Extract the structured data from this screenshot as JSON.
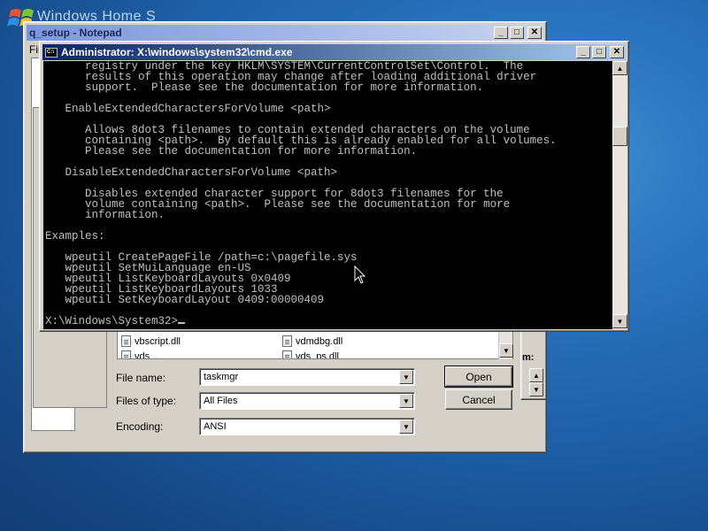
{
  "desktop": {
    "background_text": "Windows Home S"
  },
  "notepad": {
    "title": "q_setup - Notepad",
    "menu_first": "Fil"
  },
  "open_dialog": {
    "files": [
      {
        "name": "vbscript.dll"
      },
      {
        "name": "vdmdbg.dll"
      },
      {
        "name": "vds..."
      },
      {
        "name": "vds_ps.dll"
      }
    ],
    "file_name_label": "File name:",
    "file_name_value": "taskmgr",
    "files_of_type_label": "Files of type:",
    "files_of_type_value": "All Files",
    "encoding_label": "Encoding:",
    "encoding_value": "ANSI",
    "open_button": "Open",
    "cancel_button": "Cancel"
  },
  "background_window": {
    "partial_text": "m:"
  },
  "cmd": {
    "title": "Administrator: X:\\windows\\system32\\cmd.exe",
    "lines": [
      "      registry under the key HKLM\\SYSTEM\\CurrentControlSet\\Control.  The",
      "      results of this operation may change after loading additional driver",
      "      support.  Please see the documentation for more information.",
      "",
      "   EnableExtendedCharactersForVolume <path>",
      "",
      "      Allows 8dot3 filenames to contain extended characters on the volume",
      "      containing <path>.  By default this is already enabled for all volumes.",
      "      Please see the documentation for more information.",
      "",
      "   DisableExtendedCharactersForVolume <path>",
      "",
      "      Disables extended character support for 8dot3 filenames for the",
      "      volume containing <path>.  Please see the documentation for more",
      "      information.",
      "",
      "Examples:",
      "",
      "   wpeutil CreatePageFile /path=c:\\pagefile.sys",
      "   wpeutil SetMuiLanguage en-US",
      "   wpeutil ListKeyboardLayouts 0x0409",
      "   wpeutil ListKeyboardLayouts 1033",
      "   wpeutil SetKeyboardLayout 0409:00000409",
      ""
    ],
    "prompt": "X:\\Windows\\System32>"
  },
  "colors": {
    "console_bg": "#000000",
    "console_fg": "#c0c0c0",
    "title_active": "#0a246a",
    "window_face": "#d4d0c8"
  }
}
